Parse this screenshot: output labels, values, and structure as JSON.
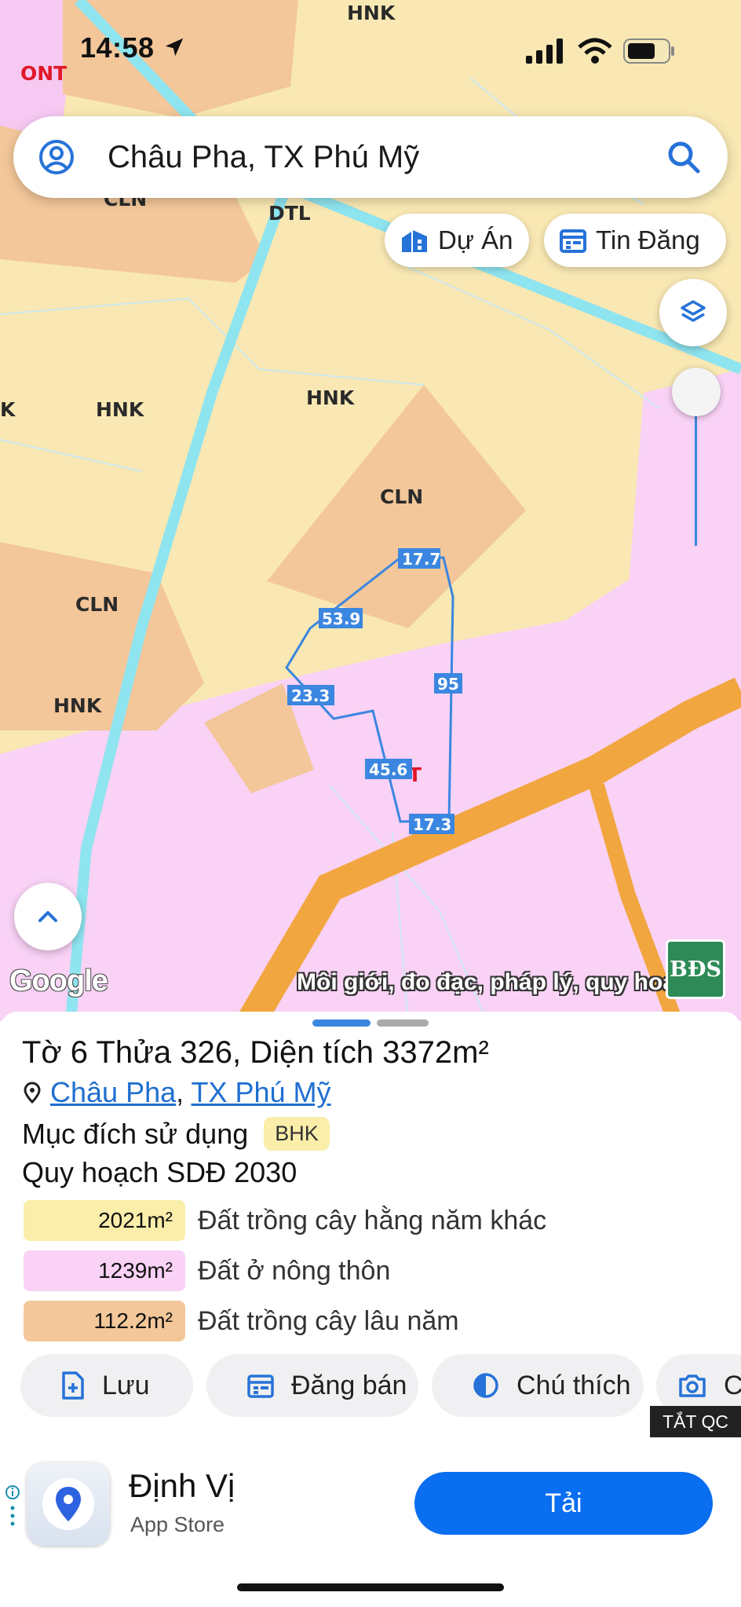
{
  "status_bar": {
    "time": "14:58"
  },
  "search": {
    "text": "Châu Pha, TX Phú Mỹ"
  },
  "chips": {
    "du_an": "Dự Án",
    "tin_dang": "Tin Đăng"
  },
  "map": {
    "zone_labels": {
      "hnk_top": "HNK",
      "ont": "ONT",
      "cln_a": "CLN",
      "dtl": "DTL",
      "hnk_b": "HNK",
      "hnk_c": "HNK",
      "cln_b": "CLN",
      "cln_c": "CLN",
      "hnk_d": "HNK",
      "k": "K",
      "ont_t": "T"
    },
    "edge_lengths": {
      "e1": "17.7",
      "e2": "53.9",
      "e3": "23.3",
      "e4": "95",
      "e5": "45.6",
      "e6": "17.3"
    },
    "google": "Google",
    "watermark": "Môi giới, đo đạc, pháp lý, quy hoạ",
    "bds_logo": "BĐS"
  },
  "sheet": {
    "title": "Tờ 6 Thửa 326, Diện tích 3372m²",
    "location_commune": "Châu Pha",
    "location_sep": ",",
    "location_town": "TX Phú Mỹ",
    "purpose_label": "Mục đích sử dụng",
    "purpose_badge": "BHK",
    "plan_title": "Quy hoạch SDĐ 2030",
    "land_uses": [
      {
        "area": "2021m²",
        "desc": "Đất trồng cây hằng năm khác",
        "color": "#faeeaa"
      },
      {
        "area": "1239m²",
        "desc": "Đất ở nông thôn",
        "color": "#f9d2f6"
      },
      {
        "area": "112.2m²",
        "desc": "Đất trồng cây lâu năm",
        "color": "#f3c79a"
      }
    ],
    "actions": {
      "save": "Lưu",
      "post": "Đăng bán",
      "legend": "Chú thích",
      "more": "C"
    },
    "ad_close": "TẮT QC"
  },
  "ad": {
    "title": "Định Vị",
    "store": "App Store",
    "cta": "Tải"
  },
  "colors": {
    "accent": "#3b86e0",
    "cta": "#0a6ef0",
    "pink_zone": "#f9d2f6",
    "yellow_zone": "#f9e8b3",
    "orange_zone": "#f3c79a",
    "road": "#f2a640"
  }
}
